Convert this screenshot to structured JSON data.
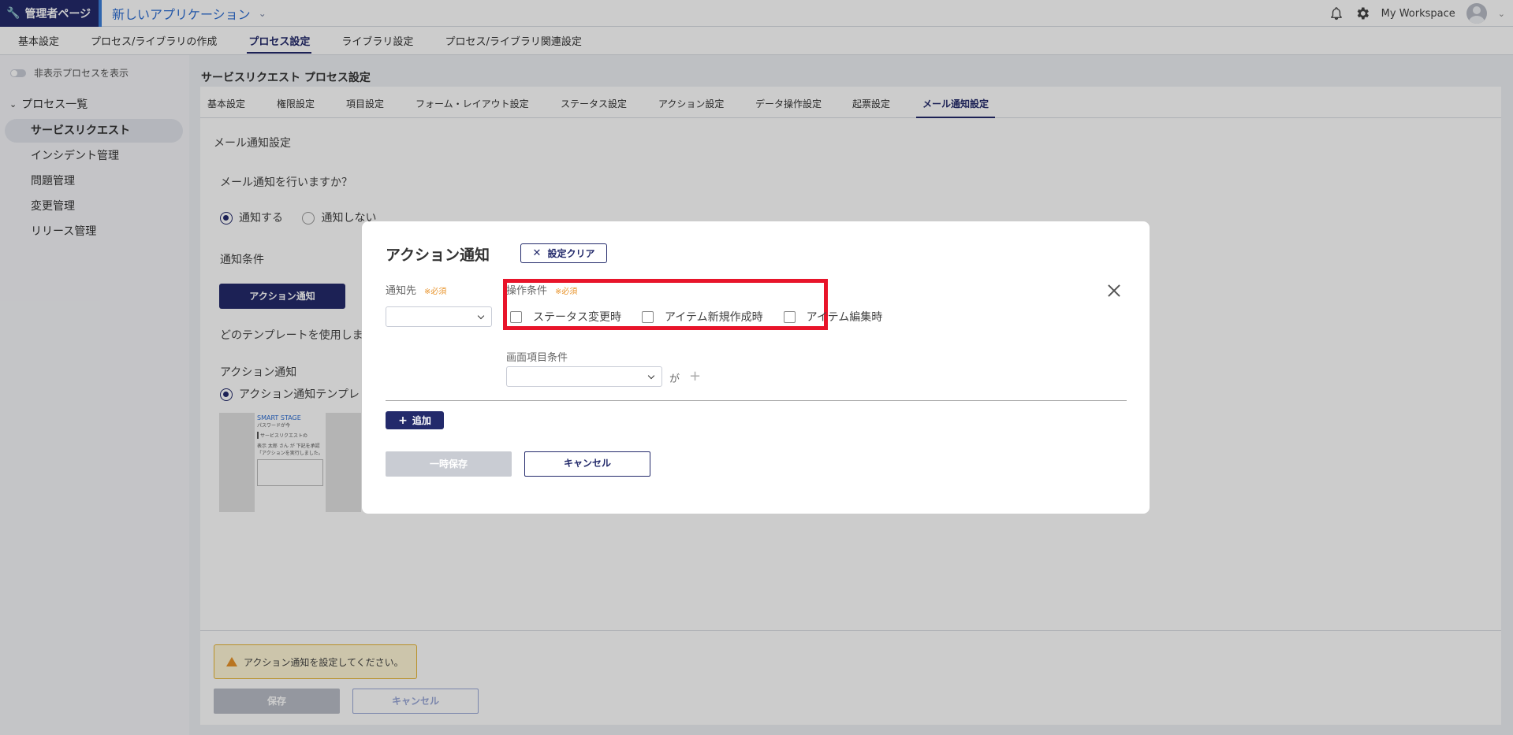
{
  "topbar": {
    "admin_label": "管理者ページ",
    "app_title": "新しいアプリケーション",
    "workspace": "My Workspace"
  },
  "mainnav": {
    "items": [
      "基本設定",
      "プロセス/ライブラリの作成",
      "プロセス設定",
      "ライブラリ設定",
      "プロセス/ライブラリ関連設定"
    ],
    "active": "プロセス設定"
  },
  "sidebar": {
    "toggle_label": "非表示プロセスを表示",
    "header": "プロセス一覧",
    "items": [
      "サービスリクエスト",
      "インシデント管理",
      "問題管理",
      "変更管理",
      "リリース管理"
    ],
    "active": "サービスリクエスト"
  },
  "content": {
    "title": "サービスリクエスト プロセス設定",
    "tabs": [
      "基本設定",
      "権限設定",
      "項目設定",
      "フォーム・レイアウト設定",
      "ステータス設定",
      "アクション設定",
      "データ操作設定",
      "起票設定",
      "メール通知設定"
    ],
    "active_tab": "メール通知設定",
    "section_title": "メール通知設定",
    "question": "メール通知を行いますか？",
    "radio_on": "通知する",
    "radio_off": "通知しない",
    "condition_label": "通知条件",
    "action_button": "アクション通知",
    "template_question": "どのテンプレートを使用しま",
    "template_label": "アクション通知",
    "template_radio": "アクション通知テンプレ",
    "thumb_brand": "SMART STAGE",
    "thumb_line1": "パスワードが今",
    "thumb_line2": "サービスリクエストの",
    "thumb_line3": "表示 太郎 さん が 下記を承認 「アクションを実行しました。",
    "warning": "アクション通知を設定してください。",
    "save_button": "保存",
    "cancel_button": "キャンセル"
  },
  "modal": {
    "title": "アクション通知",
    "clear_button": "設定クリア",
    "recipient_label": "通知先",
    "required": "※必須",
    "operation_label": "操作条件",
    "checkboxes": [
      "ステータス変更時",
      "アイテム新規作成時",
      "アイテム編集時"
    ],
    "screen_condition_label": "画面項目条件",
    "ga": "が",
    "add_button": "追加",
    "temp_save_button": "一時保存",
    "cancel_button": "キャンセル"
  },
  "colors": {
    "brand": "#232a6b",
    "accent": "#2f6fd3",
    "highlight": "#e8142a",
    "warning": "#e8932a"
  }
}
